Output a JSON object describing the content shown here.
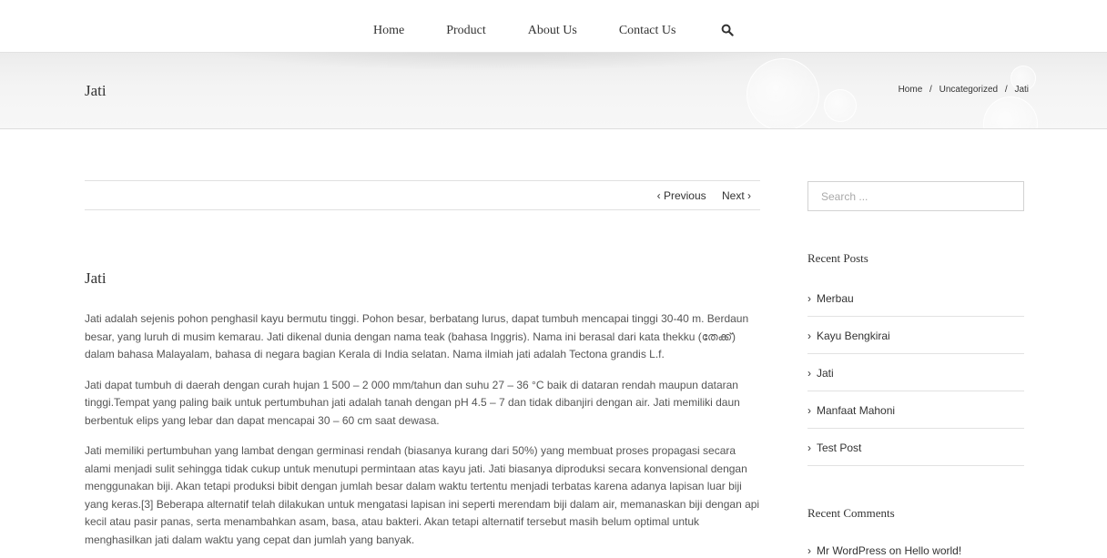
{
  "nav": {
    "items": [
      {
        "label": "Home"
      },
      {
        "label": "Product"
      },
      {
        "label": "About Us"
      },
      {
        "label": "Contact Us"
      }
    ],
    "search_icon": "search-icon"
  },
  "page_title": "Jati",
  "breadcrumb": {
    "items": [
      "Home",
      "Uncategorized",
      "Jati"
    ],
    "separator": "/"
  },
  "post_nav": {
    "previous": "‹ Previous",
    "next": "Next ›"
  },
  "post": {
    "title": "Jati",
    "paragraphs": [
      "Jati adalah sejenis pohon penghasil kayu bermutu tinggi. Pohon besar, berbatang lurus, dapat tumbuh mencapai tinggi 30-40 m. Berdaun besar, yang luruh di musim kemarau. Jati dikenal dunia dengan nama teak (bahasa Inggris). Nama ini berasal dari kata thekku (തേക്ക്) dalam bahasa Malayalam, bahasa di negara bagian Kerala di India selatan. Nama ilmiah jati adalah Tectona grandis L.f.",
      "Jati dapat tumbuh di daerah dengan curah hujan 1 500 – 2 000 mm/tahun dan suhu 27 – 36 °C baik di dataran rendah maupun dataran tinggi.Tempat yang paling baik untuk pertumbuhan jati adalah tanah dengan pH 4.5 – 7 dan tidak dibanjiri dengan air. Jati memiliki daun berbentuk elips yang lebar dan dapat mencapai 30 – 60 cm saat dewasa.",
      "Jati memiliki pertumbuhan yang lambat dengan germinasi rendah (biasanya kurang dari 50%) yang membuat proses propagasi secara alami menjadi sulit sehingga tidak cukup untuk menutupi permintaan atas kayu jati. Jati biasanya diproduksi secara konvensional dengan menggunakan biji. Akan tetapi produksi bibit dengan jumlah besar dalam waktu tertentu menjadi terbatas karena adanya lapisan luar biji yang keras.[3] Beberapa alternatif telah dilakukan untuk mengatasi lapisan ini seperti merendam biji dalam air, memanaskan biji dengan api kecil atau pasir panas, serta menambahkan asam, basa, atau bakteri. Akan tetapi alternatif tersebut masih belum optimal untuk menghasilkan jati dalam waktu yang cepat dan jumlah yang banyak."
    ]
  },
  "sidebar": {
    "search_placeholder": "Search ...",
    "recent_posts_title": "Recent Posts",
    "recent_posts": [
      "Merbau",
      "Kayu Bengkirai",
      "Jati",
      "Manfaat Mahoni",
      "Test Post"
    ],
    "recent_comments_title": "Recent Comments",
    "recent_comment": "Mr WordPress on Hello world!"
  }
}
